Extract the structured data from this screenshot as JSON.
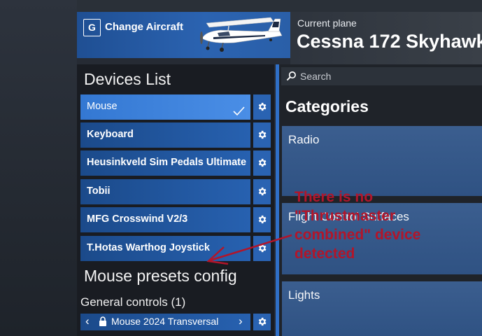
{
  "header": {
    "change_key": "G",
    "change_label": "Change Aircraft",
    "current_label": "Current plane",
    "plane_name": "Cessna 172 Skyhawk"
  },
  "devices": {
    "title": "Devices List",
    "items": [
      {
        "label": "Mouse",
        "selected": true
      },
      {
        "label": "Keyboard",
        "selected": false
      },
      {
        "label": "Heusinkveld Sim Pedals Ultimate",
        "selected": false
      },
      {
        "label": "Tobii",
        "selected": false
      },
      {
        "label": "MFG Crosswind V2/3",
        "selected": false
      },
      {
        "label": "T.Hotas Warthog Joystick",
        "selected": false
      }
    ]
  },
  "presets": {
    "title": "Mouse presets config",
    "general_controls": "General controls (1)",
    "preset_name": "Mouse 2024 Transversal"
  },
  "search": {
    "placeholder": "Search"
  },
  "categories": {
    "title": "Categories",
    "items": [
      "Radio",
      "Flight Control Surfaces",
      "Lights"
    ]
  },
  "annotation": {
    "lines": [
      "There is no",
      "\"Thrustmaster",
      "combined\" device",
      "detected"
    ]
  },
  "colors": {
    "accent_blue": "#2f6fc7",
    "selected_blue": "#3a7fd8",
    "annotation_red": "#b2152a"
  }
}
